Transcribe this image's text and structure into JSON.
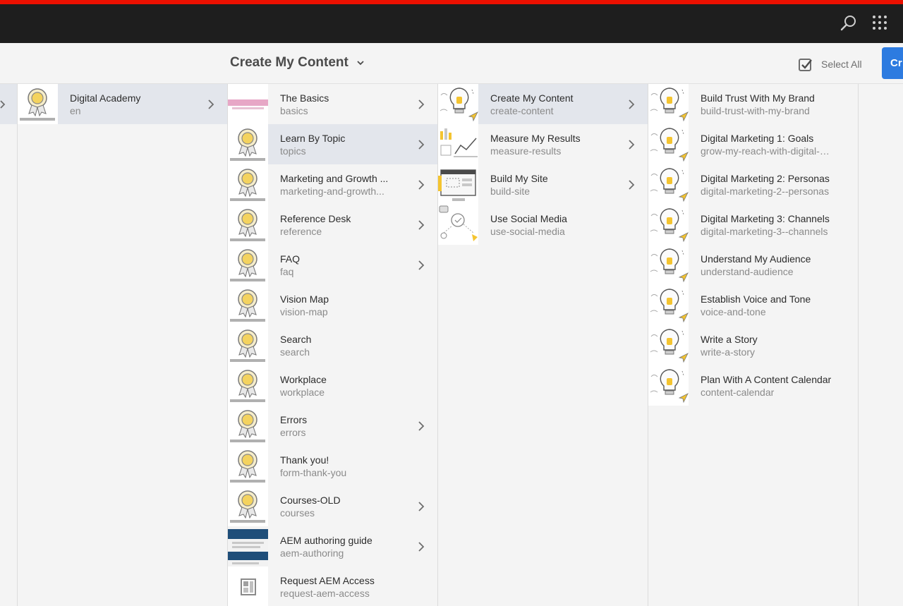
{
  "header": {
    "title": "Create My Content",
    "select_all_label": "Select All",
    "create_button_label": "Cr"
  },
  "columns": [
    {
      "items": [
        {
          "title": "Digital Academy",
          "name": "en",
          "has_children": true,
          "selected": true,
          "thumb": "award"
        }
      ]
    },
    {
      "items": [
        {
          "title": "The Basics",
          "name": "basics",
          "has_children": true,
          "selected": false,
          "thumb": "banner"
        },
        {
          "title": "Learn By Topic",
          "name": "topics",
          "has_children": true,
          "selected": true,
          "thumb": "award"
        },
        {
          "title": "Marketing and Growth ...",
          "name": "marketing-and-growth...",
          "has_children": true,
          "selected": false,
          "thumb": "award"
        },
        {
          "title": "Reference Desk",
          "name": "reference",
          "has_children": true,
          "selected": false,
          "thumb": "award"
        },
        {
          "title": "FAQ",
          "name": "faq",
          "has_children": true,
          "selected": false,
          "thumb": "award"
        },
        {
          "title": "Vision Map",
          "name": "vision-map",
          "has_children": false,
          "selected": false,
          "thumb": "award"
        },
        {
          "title": "Search",
          "name": "search",
          "has_children": false,
          "selected": false,
          "thumb": "award"
        },
        {
          "title": "Workplace",
          "name": "workplace",
          "has_children": false,
          "selected": false,
          "thumb": "award"
        },
        {
          "title": "Errors",
          "name": "errors",
          "has_children": true,
          "selected": false,
          "thumb": "award"
        },
        {
          "title": "Thank you!",
          "name": "form-thank-you",
          "has_children": false,
          "selected": false,
          "thumb": "award"
        },
        {
          "title": "Courses-OLD",
          "name": "courses",
          "has_children": true,
          "selected": false,
          "thumb": "award"
        },
        {
          "title": "AEM authoring guide",
          "name": "aem-authoring",
          "has_children": true,
          "selected": false,
          "thumb": "doc"
        },
        {
          "title": "Request AEM Access",
          "name": "request-aem-access",
          "has_children": false,
          "selected": false,
          "thumb": "template"
        }
      ]
    },
    {
      "items": [
        {
          "title": "Create My Content",
          "name": "create-content",
          "has_children": true,
          "selected": true,
          "thumb": "bulb"
        },
        {
          "title": "Measure My Results",
          "name": "measure-results",
          "has_children": true,
          "selected": false,
          "thumb": "chart"
        },
        {
          "title": "Build My Site",
          "name": "build-site",
          "has_children": true,
          "selected": false,
          "thumb": "site"
        },
        {
          "title": "Use Social Media",
          "name": "use-social-media",
          "has_children": false,
          "selected": false,
          "thumb": "social"
        }
      ]
    },
    {
      "items": [
        {
          "title": "Build Trust With My Brand",
          "name": "build-trust-with-my-brand",
          "has_children": false,
          "selected": false,
          "thumb": "bulb"
        },
        {
          "title": "Digital Marketing 1: Goals",
          "name": "grow-my-reach-with-digital-m...",
          "has_children": false,
          "selected": false,
          "thumb": "bulb"
        },
        {
          "title": "Digital Marketing 2: Personas",
          "name": "digital-marketing-2--personas",
          "has_children": false,
          "selected": false,
          "thumb": "bulb"
        },
        {
          "title": "Digital Marketing 3: Channels",
          "name": "digital-marketing-3--channels",
          "has_children": false,
          "selected": false,
          "thumb": "bulb"
        },
        {
          "title": "Understand My Audience",
          "name": "understand-audience",
          "has_children": false,
          "selected": false,
          "thumb": "bulb"
        },
        {
          "title": "Establish Voice and Tone",
          "name": "voice-and-tone",
          "has_children": false,
          "selected": false,
          "thumb": "bulb"
        },
        {
          "title": "Write a Story",
          "name": "write-a-story",
          "has_children": false,
          "selected": false,
          "thumb": "bulb"
        },
        {
          "title": "Plan With A Content Calendar",
          "name": "content-calendar",
          "has_children": false,
          "selected": false,
          "thumb": "bulb"
        }
      ]
    }
  ]
}
